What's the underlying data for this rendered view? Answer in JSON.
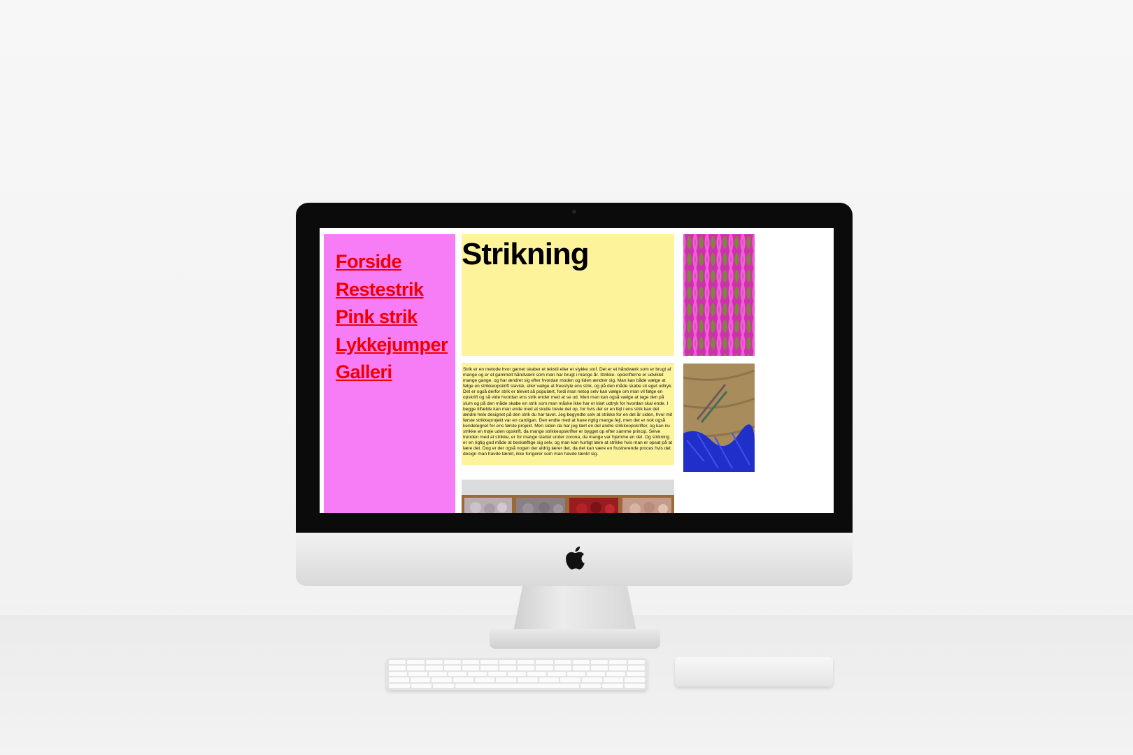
{
  "site": {
    "nav": [
      {
        "label": "Forside"
      },
      {
        "label": "Restestrik"
      },
      {
        "label": "Pink strik"
      },
      {
        "label": "Lykkejumper"
      },
      {
        "label": "Galleri"
      }
    ],
    "title": "Strikning",
    "body": "Strik er en metode hvor garnet skaber et tekstil eller et stykke stof. Det er et håndværk som er brugt af mange og er et gammelt håndværk som man har brugt i mange år. Strikke- opskrifterne er udviklet mange gange, og har ændret sig efter hvordan moden og tiden ændrer sig. Man kan både vælge at følge en strikkeopskrift slavisk, eller vælge at freestyle ens strik, og på den måde skabe sit eget udtryk. Det er også derfor strik er blevet så populært, fordi man netop selv kan vælge om man vil følge en opskrift og så vide hvordan ens strik ender med at se ud. Men man kan også vælge at tage den på slum og på den måde skabe en strik som man måske ikke har et klart udtryk for hvordan skal ende. I begge tilfælde kan man ende med at skulle trevle det op, for hvis der er en fejl i ens strik kan det ændre hele designet på den strik du har lavet. Jeg begyndte selv at strikke for en del år siden, hvor mit første strikkeprojekt var en cardigan. Den endte med at have rigtig mange fejl, men det er nok også kendetegnet for ens første projekt. Men siden da har jeg lært en del andre strikkeopskrifter, og kan nu strikke en trøje uden opskrift, da mange strikkeopskrifter er bygget op efter samme princip. Selve trenden med at strikke, er for mange startet under corona, da mange var hjemme en del. Og strikning er en rigtig god måde at beskæftige sig selv, og man kan hurtigt lære at strikke hvis man er opsat på at lære det. Dog er der også nogen der aldrig lærer det, da det kan være en frustrerende proces hvis det design man havde tænkt, ikke fungerer som man havde tænkt sig."
  },
  "colors": {
    "nav_bg": "#f77df6",
    "link": "#f00000",
    "content_bg": "#fdf39b"
  },
  "images": [
    {
      "name": "pink-knit-photo"
    },
    {
      "name": "blue-yarn-needles-photo"
    },
    {
      "name": "yarn-shelf-photo"
    }
  ]
}
